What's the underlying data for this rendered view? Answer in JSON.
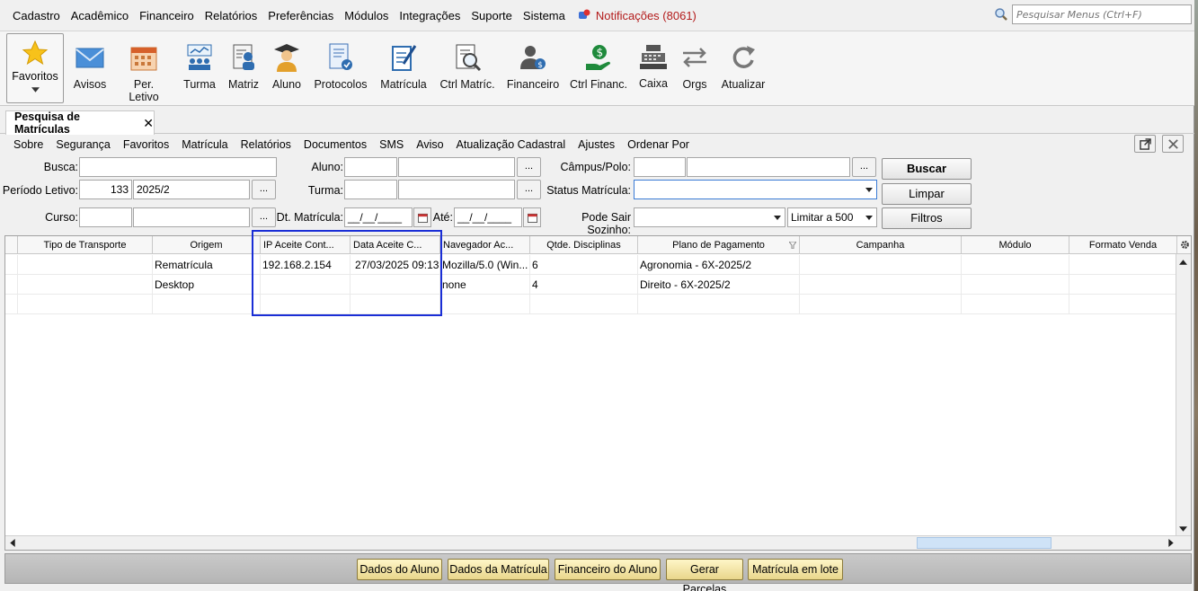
{
  "menubar": {
    "items": [
      "Cadastro",
      "Acadêmico",
      "Financeiro",
      "Relatórios",
      "Preferências",
      "Módulos",
      "Integrações",
      "Suporte",
      "Sistema"
    ],
    "notifications": "Notificações (8061)",
    "search_placeholder": "Pesquisar Menus (Ctrl+F)"
  },
  "toolbar": {
    "favorites": "Favoritos",
    "buttons": [
      "Avisos",
      "Per. Letivo",
      "Turma",
      "Matriz",
      "Aluno",
      "Protocolos",
      "Matrícula",
      "Ctrl Matríc.",
      "Financeiro",
      "Ctrl Financ.",
      "Caixa",
      "Orgs",
      "Atualizar"
    ]
  },
  "tab": {
    "label": "Pesquisa de Matrículas",
    "close": "✕"
  },
  "submenu": [
    "Sobre",
    "Segurança",
    "Favoritos",
    "Matrícula",
    "Relatórios",
    "Documentos",
    "SMS",
    "Aviso",
    "Atualização Cadastral",
    "Ajustes",
    "Ordenar Por"
  ],
  "form": {
    "busca_label": "Busca:",
    "periodo_label": "Período Letivo:",
    "periodo_code": "133",
    "periodo_value": "2025/2",
    "curso_label": "Curso:",
    "aluno_label": "Aluno:",
    "turma_label": "Turma:",
    "dt_matricula_label": "Dt. Matrícula:",
    "date_placeholder": "__/__/____",
    "ate_label": "Até:",
    "campus_label": "Câmpus/Polo:",
    "status_label": "Status Matrícula:",
    "pode_sair_label": "Pode Sair Sozinho:",
    "limitar": "Limitar a 500",
    "dots": "...",
    "buscar": "Buscar",
    "limpar": "Limpar",
    "filtros": "Filtros"
  },
  "grid": {
    "columns": [
      "Tipo de Transporte",
      "Origem",
      "IP Aceite Cont...",
      "Data Aceite C...",
      "Navegador Ac...",
      "Qtde. Disciplinas",
      "Plano de Pagamento",
      "Campanha",
      "Módulo",
      "Formato Venda"
    ],
    "rows": [
      [
        "",
        "Rematrícula",
        "192.168.2.154",
        "27/03/2025 09:13",
        "Mozilla/5.0 (Win...",
        "6",
        "Agronomia - 6X-2025/2",
        "",
        "",
        ""
      ],
      [
        "",
        "Desktop",
        "",
        "",
        "none",
        "4",
        "Direito - 6X-2025/2",
        "",
        "",
        ""
      ],
      [
        "",
        "",
        "",
        "",
        "",
        "",
        "",
        "",
        "",
        ""
      ]
    ]
  },
  "bottom_buttons": [
    "Dados do Aluno",
    "Dados da Matrícula",
    "Financeiro do Aluno",
    "Gerar Parcelas",
    "Matrícula em lote"
  ],
  "colors": {
    "highlight": "#1a2ed6",
    "notification": "#b31b1b",
    "bottom_button": "#e9d68b"
  }
}
